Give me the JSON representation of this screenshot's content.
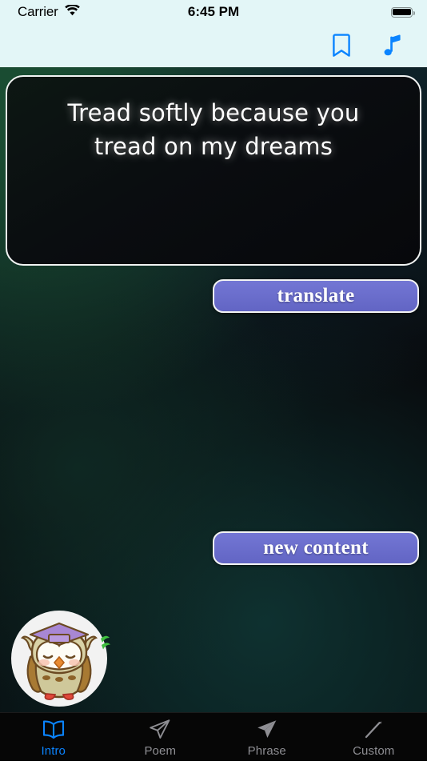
{
  "status_bar": {
    "carrier": "Carrier",
    "wifi_icon": "wifi-icon",
    "time": "6:45 PM",
    "battery_icon": "battery-full-icon"
  },
  "nav_bar": {
    "bookmark_icon": "bookmark-icon",
    "music_icon": "music-note-icon",
    "icon_color": "#0a84ff",
    "background": "#e3f6f7"
  },
  "content": {
    "quote_line1": "Tread softly because you",
    "quote_line2": "tread on my dreams",
    "quote_full": "Tread softly because you tread on my dreams"
  },
  "buttons": {
    "translate_label": "translate",
    "new_content_label": "new content",
    "accent_color": "#6265c4",
    "border_color": "#f3f4f4"
  },
  "avatar": {
    "name": "owl-mascot-avatar",
    "cap_color": "#a887d4",
    "body_color": "#d6cfa0",
    "leaf_color": "#3fbf3f"
  },
  "tab_bar": {
    "active_color": "#0a84ff",
    "inactive_color": "#8e8e93",
    "tabs": [
      {
        "label": "Intro",
        "icon": "book-icon",
        "active": true
      },
      {
        "label": "Poem",
        "icon": "paper-plane-outline-icon",
        "active": false
      },
      {
        "label": "Phrase",
        "icon": "paper-plane-filled-icon",
        "active": false
      },
      {
        "label": "Custom",
        "icon": "pencil-icon",
        "active": false
      }
    ]
  }
}
